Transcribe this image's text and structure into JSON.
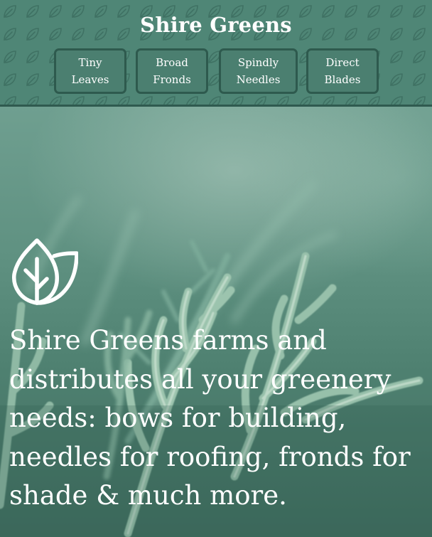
{
  "header": {
    "title": "Shire Greens",
    "nav": [
      {
        "line1": "Tiny",
        "line2": "Leaves"
      },
      {
        "line1": "Broad",
        "line2": "Fronds"
      },
      {
        "line1": "Spindly",
        "line2": "Needles"
      },
      {
        "line1": "Direct",
        "line2": "Blades"
      }
    ]
  },
  "hero": {
    "logo_icon": "leaf-logo-icon",
    "text": "Shire Greens farms and distributes all your greenery needs: bows for building, needles for roofing, fronds for shade & much more."
  },
  "colors": {
    "header_bg": "#4f8676",
    "nav_border": "#2e5a4e",
    "text": "#ffffff"
  }
}
